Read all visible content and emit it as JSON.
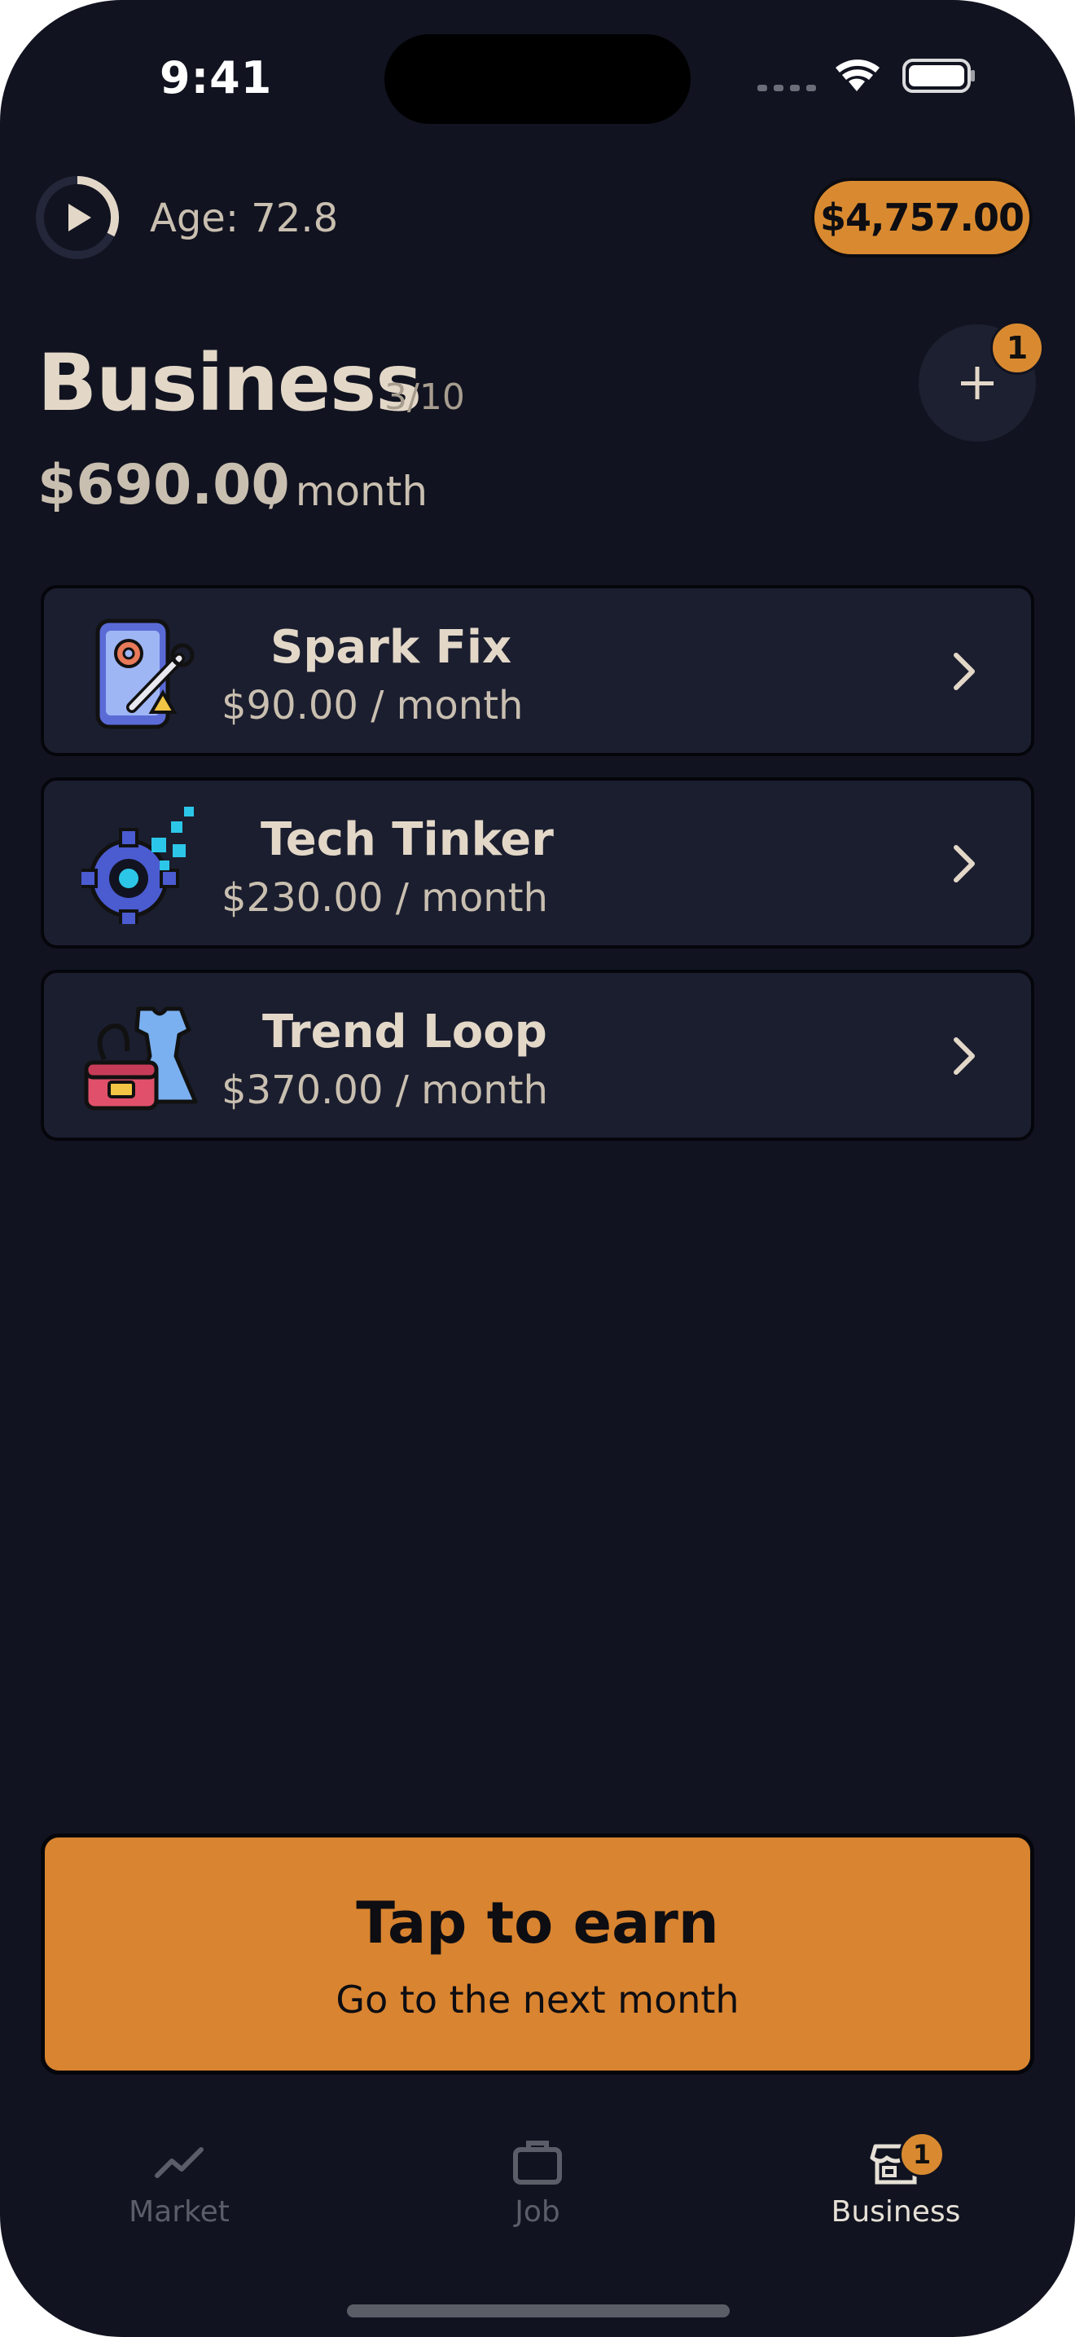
{
  "status_bar": {
    "time": "9:41"
  },
  "header": {
    "age_label": "Age: 72.8",
    "cash": "$4,757.00"
  },
  "page": {
    "title": "Business",
    "count": "3/10",
    "monthly_total": "$690.00",
    "monthly_unit": "/ month",
    "add_badge": "1"
  },
  "businesses": [
    {
      "name": "Spark Fix",
      "income": "$90.00 / month",
      "icon": "phone-repair-icon"
    },
    {
      "name": "Tech Tinker",
      "income": "$230.00 / month",
      "icon": "gear-pixels-icon"
    },
    {
      "name": "Trend Loop",
      "income": "$370.00 / month",
      "icon": "dress-handbag-icon"
    }
  ],
  "earn_button": {
    "title": "Tap to earn",
    "subtitle": "Go to the next month"
  },
  "tab_bar": {
    "items": [
      {
        "label": "Market",
        "icon": "chart-line-icon",
        "active": false
      },
      {
        "label": "Job",
        "icon": "briefcase-icon",
        "active": false
      },
      {
        "label": "Business",
        "icon": "storefront-icon",
        "active": true,
        "badge": "1"
      }
    ]
  },
  "colors": {
    "background": "#111320",
    "card": "#1b1e2f",
    "accent": "#d98a30",
    "text_primary": "#e3d8c8",
    "text_secondary": "#c9bfb0"
  }
}
